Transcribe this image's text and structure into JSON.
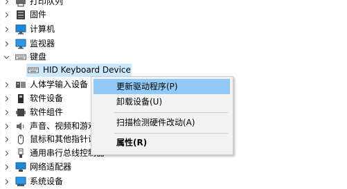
{
  "tree": {
    "items": [
      {
        "label": "打印队列",
        "icon": "printer-icon"
      },
      {
        "label": "固件",
        "icon": "firmware-icon"
      },
      {
        "label": "计算机",
        "icon": "computer-icon"
      },
      {
        "label": "监视器",
        "icon": "monitor-icon"
      },
      {
        "label": "键盘",
        "icon": "keyboard-icon",
        "expanded": true
      },
      {
        "label": "HID Keyboard Device",
        "icon": "keyboard-icon",
        "selected": true
      },
      {
        "label": "人体学输入设备",
        "icon": "hid-icon"
      },
      {
        "label": "软件设备",
        "icon": "software-device-icon"
      },
      {
        "label": "软件组件",
        "icon": "software-component-icon"
      },
      {
        "label": "声音、视频和游戏控制器",
        "icon": "audio-icon"
      },
      {
        "label": "鼠标和其他指针设备",
        "icon": "mouse-icon"
      },
      {
        "label": "通用串行总线控制器",
        "icon": "usb-icon"
      },
      {
        "label": "网络适配器",
        "icon": "network-adapter-icon"
      },
      {
        "label": "系统设备",
        "icon": "system-device-icon"
      }
    ]
  },
  "context_menu": {
    "items": [
      {
        "label": "更新驱动程序(P)",
        "highlighted": true
      },
      {
        "label": "卸载设备(U)"
      },
      {
        "label": "扫描检测硬件改动(A)"
      },
      {
        "label": "属性(R)",
        "bold": true
      }
    ]
  },
  "colors": {
    "selection": "#cce8ff",
    "menu_highlight": "#91c9f7",
    "menu_background": "#f2f2f2"
  }
}
